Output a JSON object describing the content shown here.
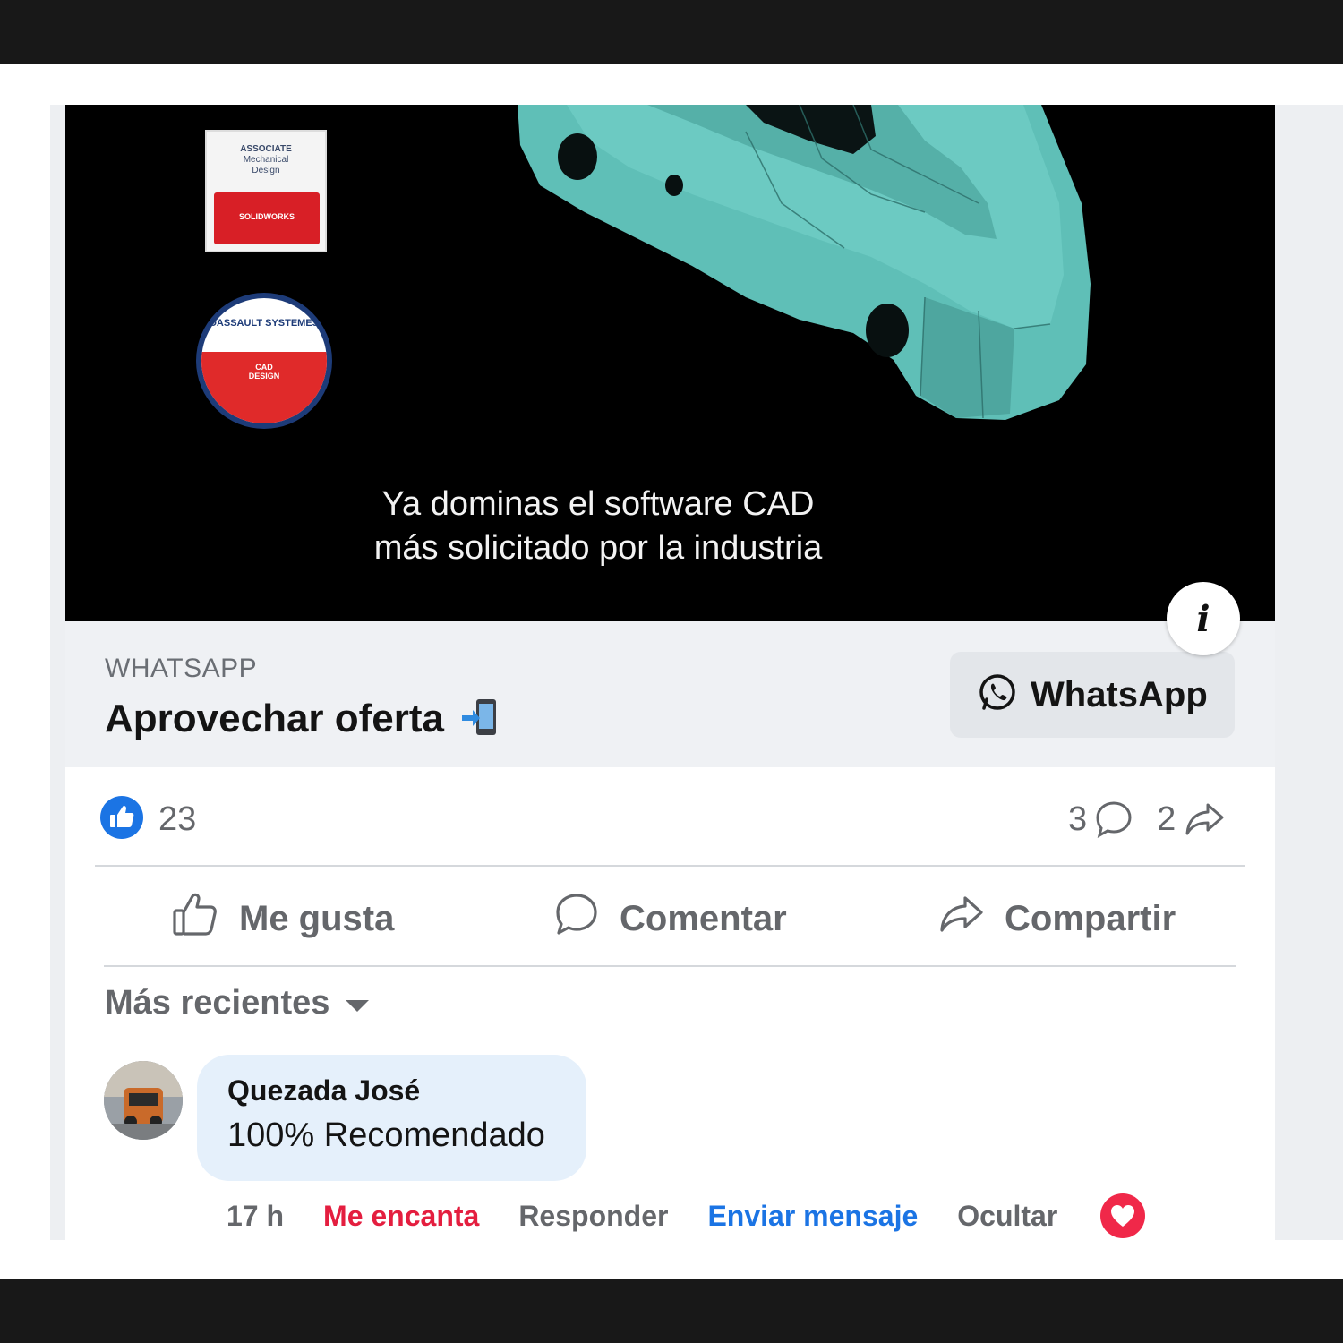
{
  "media": {
    "caption_line1": "Ya dominas el software CAD",
    "caption_line2": "más solicitado por la industria",
    "badge_square": {
      "line1": "ASSOCIATE",
      "line2": "Mechanical",
      "line3": "Design",
      "brand": "SOLIDWORKS"
    },
    "badge_circle": {
      "brand": "DASSAULT SYSTEMES",
      "sub1": "CAD",
      "sub2": "DESIGN"
    },
    "part_color": "#5fbfb7"
  },
  "info_button": {
    "label": "i"
  },
  "cta": {
    "source": "WHATSAPP",
    "headline": "Aprovechar oferta",
    "button_label": "WhatsApp",
    "button_icon": "whatsapp-icon"
  },
  "engagement": {
    "likes": "23",
    "comments": "3",
    "shares": "2",
    "like_icon": "like-reaction-icon",
    "comment_icon": "comment-icon",
    "share_icon": "share-icon"
  },
  "actions": {
    "like": "Me gusta",
    "comment": "Comentar",
    "share": "Compartir"
  },
  "sort": {
    "label": "Más recientes"
  },
  "comment": {
    "author": "Quezada José",
    "text": "100% Recomendado",
    "time": "17 h",
    "reaction": "Me encanta",
    "reply": "Responder",
    "send_message": "Enviar mensaje",
    "hide": "Ocultar"
  },
  "colors": {
    "accent_blue": "#1b74e4",
    "love_red": "#e41e3f",
    "muted_text": "#65676b",
    "bubble_bg": "#e5f0fb"
  }
}
